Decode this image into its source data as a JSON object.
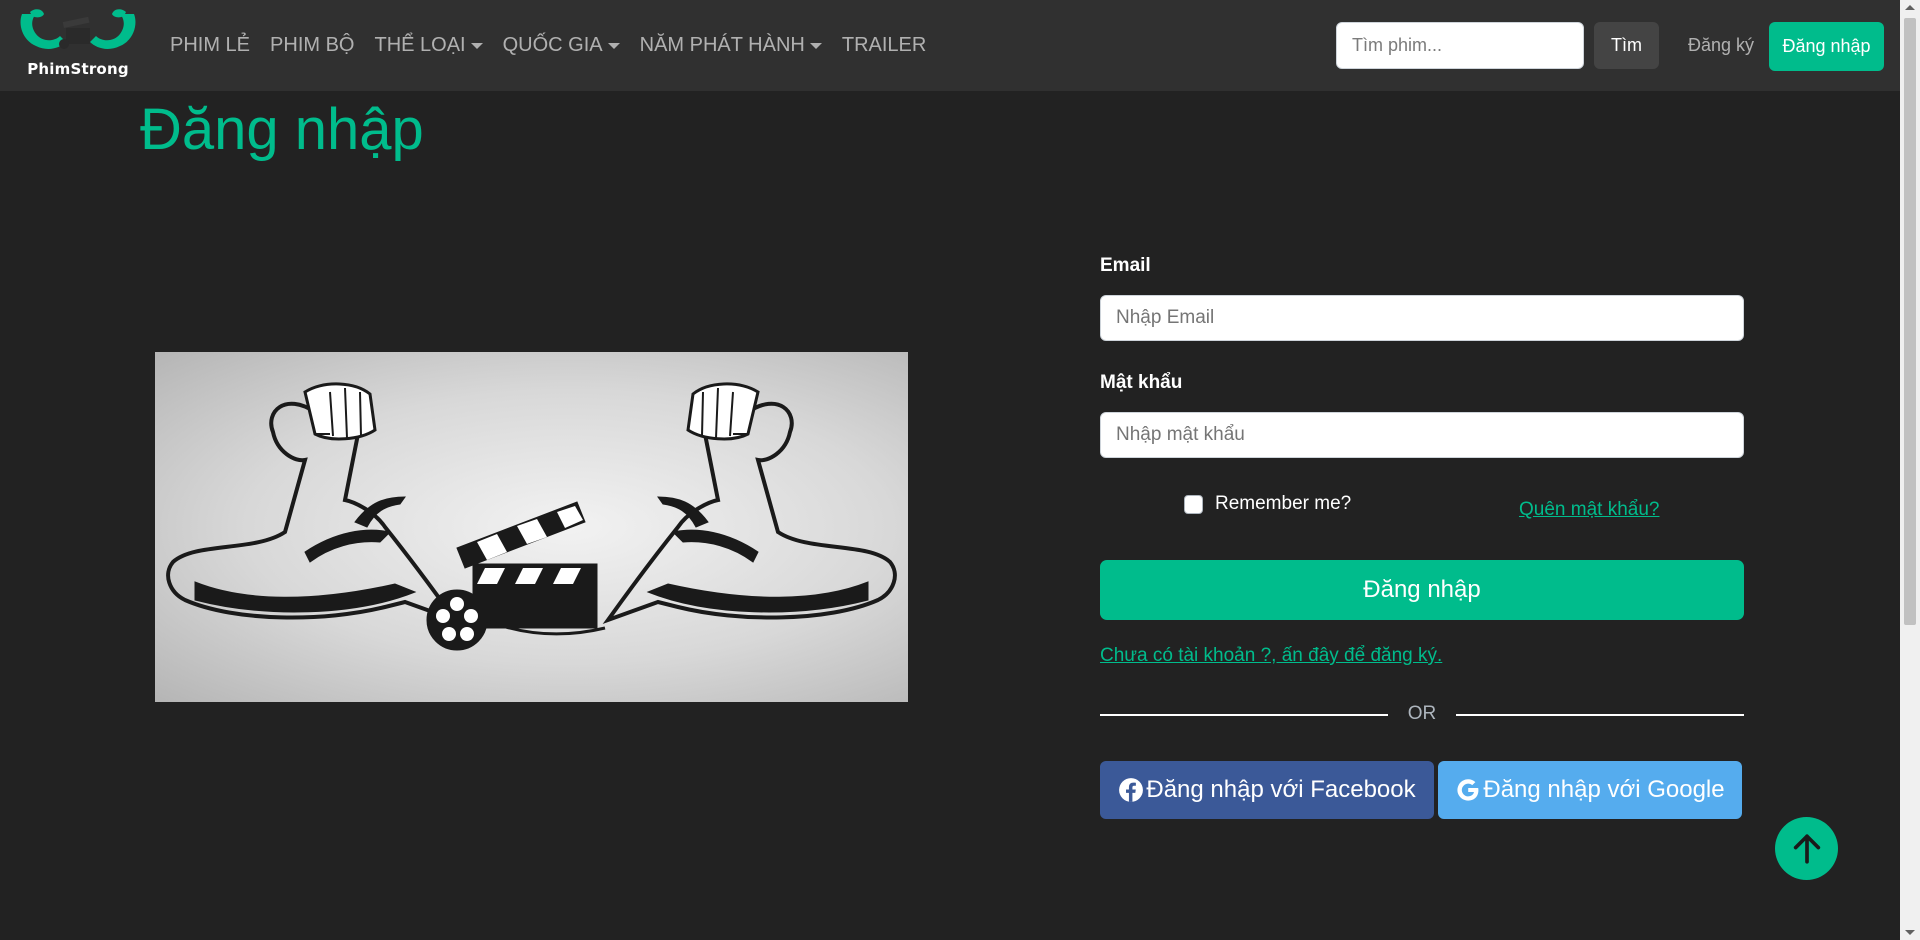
{
  "brand": {
    "name": "PhimStrong",
    "accent_color": "#00bc8c"
  },
  "nav": {
    "items": [
      {
        "label": "PHIM LẺ",
        "dropdown": false
      },
      {
        "label": "PHIM BỘ",
        "dropdown": false
      },
      {
        "label": "THỂ LOẠI",
        "dropdown": true
      },
      {
        "label": "QUỐC GIA",
        "dropdown": true
      },
      {
        "label": "NĂM PHÁT HÀNH",
        "dropdown": true
      },
      {
        "label": "TRAILER",
        "dropdown": false
      }
    ],
    "search_placeholder": "Tìm phim...",
    "search_button": "Tìm",
    "register_label": "Đăng ký",
    "login_label": "Đăng nhập"
  },
  "page": {
    "title": "Đăng nhập"
  },
  "form": {
    "email_label": "Email",
    "email_placeholder": "Nhập Email",
    "password_label": "Mật khẩu",
    "password_placeholder": "Nhập mật khẩu",
    "remember_label": "Remember me?",
    "remember_checked": false,
    "forgot_label": "Quên mật khẩu?",
    "submit_label": "Đăng nhập",
    "signup_label": "Chưa có tài khoản ?, ấn đây để đăng ký.",
    "or_label": "OR",
    "facebook_label": "Đăng nhập với Facebook",
    "google_label": "Đăng nhập với Google"
  },
  "colors": {
    "background": "#222222",
    "navbar": "#303030",
    "facebook": "#3b5998",
    "google": "#55acee"
  }
}
